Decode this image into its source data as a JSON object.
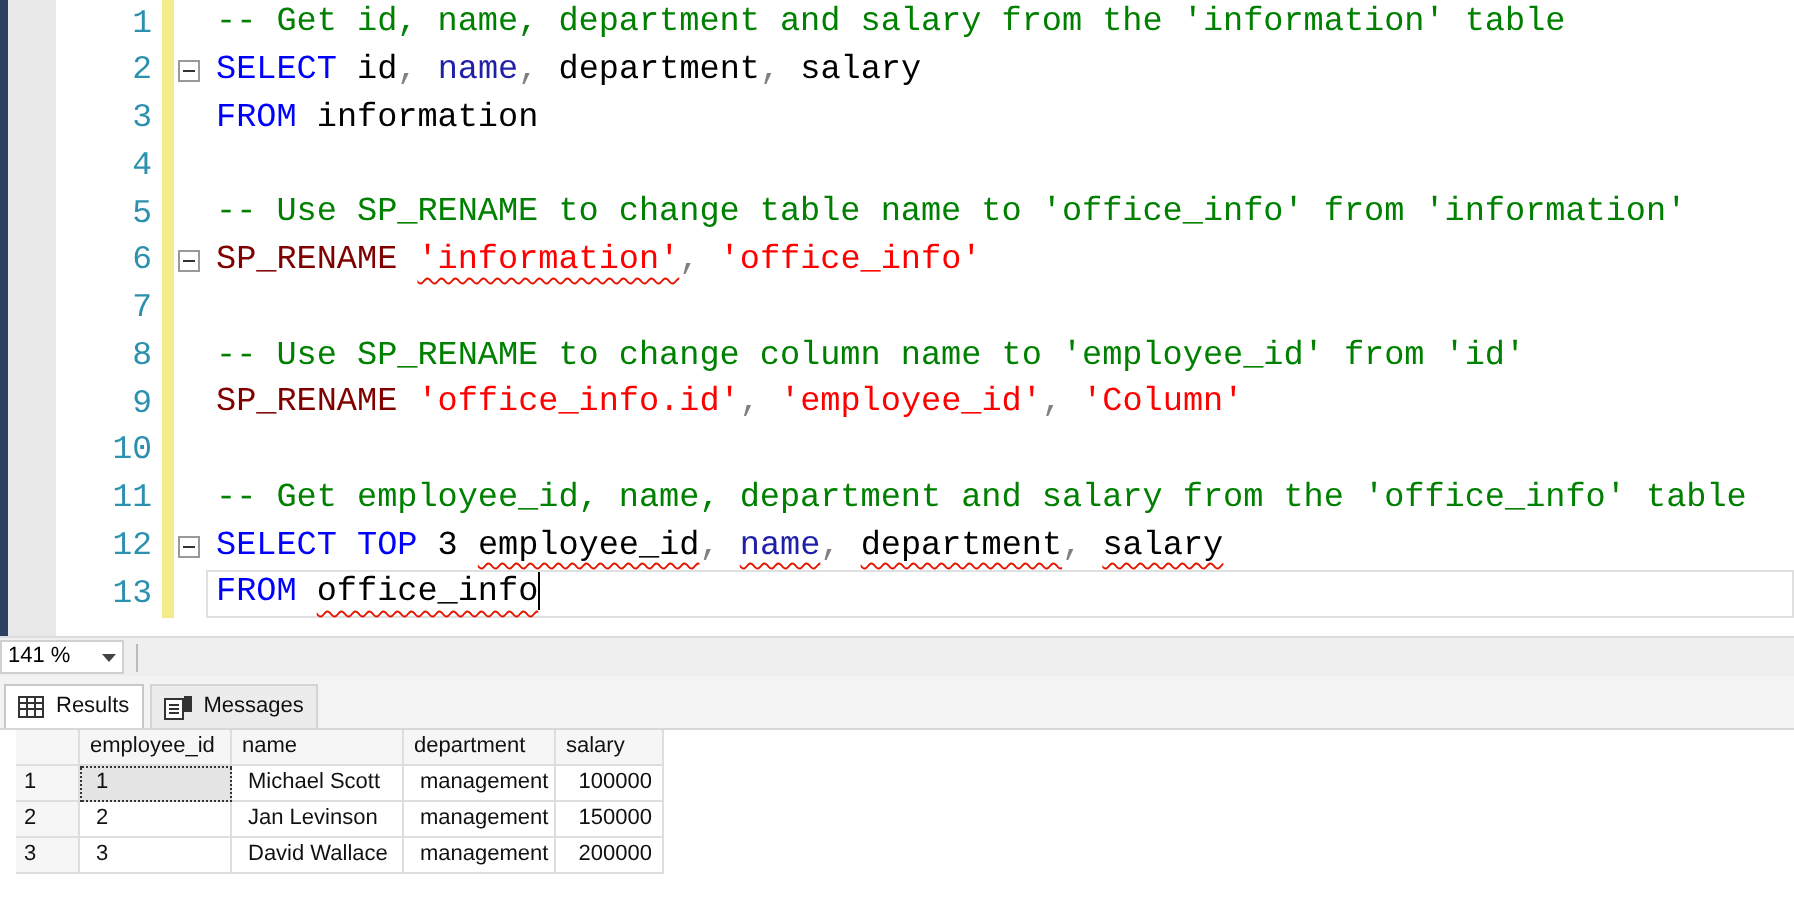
{
  "editor": {
    "lines": [
      {
        "number": "1",
        "collapsible": false,
        "current": false,
        "tokens": [
          {
            "kind": "comment",
            "text": "-- Get id, name, department and salary from the 'information' table",
            "underlined": false
          }
        ]
      },
      {
        "number": "2",
        "collapsible": true,
        "current": false,
        "tokens": [
          {
            "kind": "keyword",
            "text": "SELECT",
            "underlined": false
          },
          {
            "kind": "plain",
            "text": " id",
            "underlined": false
          },
          {
            "kind": "operator",
            "text": ", ",
            "underlined": false
          },
          {
            "kind": "builtin",
            "text": "name",
            "underlined": false
          },
          {
            "kind": "operator",
            "text": ", ",
            "underlined": false
          },
          {
            "kind": "plain",
            "text": "department",
            "underlined": false
          },
          {
            "kind": "operator",
            "text": ", ",
            "underlined": false
          },
          {
            "kind": "plain",
            "text": "salary",
            "underlined": false
          }
        ]
      },
      {
        "number": "3",
        "collapsible": false,
        "current": false,
        "tokens": [
          {
            "kind": "keyword",
            "text": "FROM",
            "underlined": false
          },
          {
            "kind": "plain",
            "text": " information",
            "underlined": false
          }
        ]
      },
      {
        "number": "4",
        "collapsible": false,
        "current": false
      },
      {
        "number": "5",
        "collapsible": false,
        "current": false,
        "tokens": [
          {
            "kind": "comment",
            "text": "-- Use SP_RENAME to change table name to 'office_info' from 'information'",
            "underlined": false
          }
        ]
      },
      {
        "number": "6",
        "collapsible": true,
        "current": false,
        "tokens": [
          {
            "kind": "procedure",
            "text": "SP_RENAME ",
            "underlined": false
          },
          {
            "kind": "string",
            "text": "'information'",
            "underlined": true
          },
          {
            "kind": "operator",
            "text": ", ",
            "underlined": false
          },
          {
            "kind": "string",
            "text": "'office_info'",
            "underlined": false
          }
        ]
      },
      {
        "number": "7",
        "collapsible": false,
        "current": false
      },
      {
        "number": "8",
        "collapsible": false,
        "current": false,
        "tokens": [
          {
            "kind": "comment",
            "text": "-- Use SP_RENAME to change column name to 'employee_id' from 'id'",
            "underlined": false
          }
        ]
      },
      {
        "number": "9",
        "collapsible": false,
        "current": false,
        "tokens": [
          {
            "kind": "procedure",
            "text": "SP_RENAME ",
            "underlined": false
          },
          {
            "kind": "string",
            "text": "'office_info.id'",
            "underlined": false
          },
          {
            "kind": "operator",
            "text": ", ",
            "underlined": false
          },
          {
            "kind": "string",
            "text": "'employee_id'",
            "underlined": false
          },
          {
            "kind": "operator",
            "text": ", ",
            "underlined": false
          },
          {
            "kind": "string",
            "text": "'Column'",
            "underlined": false
          }
        ]
      },
      {
        "number": "10",
        "collapsible": false,
        "current": false
      },
      {
        "number": "11",
        "collapsible": false,
        "current": false,
        "tokens": [
          {
            "kind": "comment",
            "text": "-- Get employee_id, name, department and salary from the 'office_info' table",
            "underlined": false
          }
        ]
      },
      {
        "number": "12",
        "collapsible": true,
        "current": false,
        "tokens": [
          {
            "kind": "keyword",
            "text": "SELECT TOP",
            "underlined": false
          },
          {
            "kind": "plain",
            "text": " 3 ",
            "underlined": false
          },
          {
            "kind": "plain",
            "text": "employee_id",
            "underlined": true
          },
          {
            "kind": "operator",
            "text": ", ",
            "underlined": false
          },
          {
            "kind": "builtin",
            "text": "name",
            "underlined": true
          },
          {
            "kind": "operator",
            "text": ", ",
            "underlined": false
          },
          {
            "kind": "plain",
            "text": "department",
            "underlined": true
          },
          {
            "kind": "operator",
            "text": ", ",
            "underlined": false
          },
          {
            "kind": "plain",
            "text": "salary",
            "underlined": true
          }
        ]
      },
      {
        "number": "13",
        "collapsible": false,
        "current": true,
        "tokens": [
          {
            "kind": "keyword",
            "text": "FROM ",
            "underlined": false
          },
          {
            "kind": "plain",
            "text": "office_info",
            "underlined": true
          }
        ]
      }
    ]
  },
  "zoom": {
    "value": "141 %"
  },
  "tabs": [
    {
      "label": "Results",
      "kind": "grid",
      "selected": true
    },
    {
      "label": "Messages",
      "kind": "messages",
      "selected": false
    }
  ],
  "results": {
    "columns": [
      "employee_id",
      "name",
      "department",
      "salary"
    ],
    "rows": [
      {
        "number": "1",
        "focused": true,
        "cells": [
          "1",
          "Michael Scott",
          "management",
          "100000"
        ]
      },
      {
        "number": "2",
        "focused": false,
        "cells": [
          "2",
          "Jan Levinson",
          "management",
          "150000"
        ]
      },
      {
        "number": "3",
        "focused": false,
        "cells": [
          "3",
          "David Wallace",
          "management",
          "200000"
        ]
      }
    ]
  }
}
